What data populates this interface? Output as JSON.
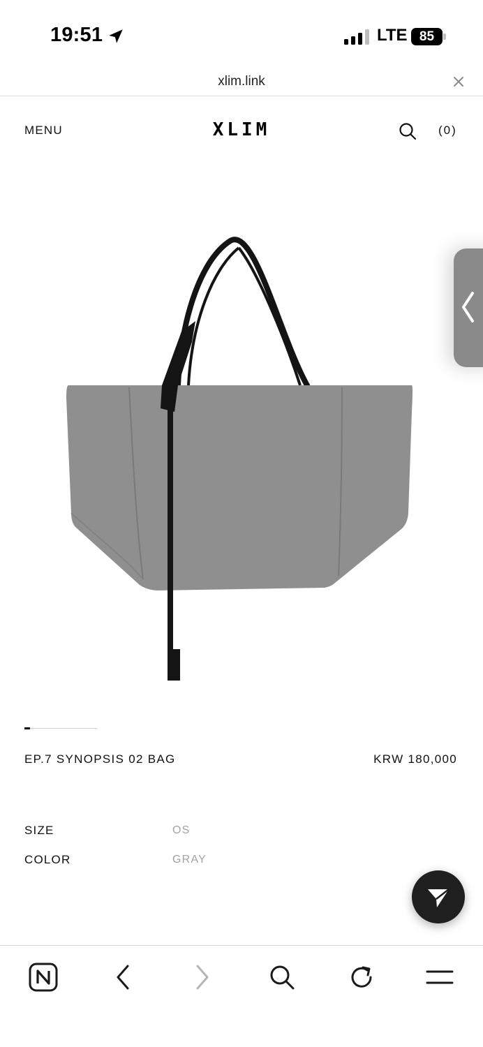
{
  "status_bar": {
    "time": "19:51",
    "network": "LTE",
    "battery": "85"
  },
  "url_bar": {
    "url": "xlim.link"
  },
  "header": {
    "menu_label": "MENU",
    "brand": "XLIM",
    "cart": "(0)"
  },
  "product": {
    "name": "EP.7 SYNOPSIS 02 BAG",
    "price": "KRW 180,000",
    "slide_progress": 0.08,
    "options": [
      {
        "label": "SIZE",
        "value": "OS"
      },
      {
        "label": "COLOR",
        "value": "GRAY"
      }
    ]
  },
  "colors": {
    "bag_gray": "#8f8f8f",
    "strap_black": "#141414",
    "fab_bg": "#1f1f1f"
  },
  "icons": {
    "location": "location-arrow-icon",
    "close": "close-icon",
    "search": "search-icon",
    "handle": "chevron-left-icon",
    "send": "paper-plane-icon",
    "toolbar": [
      "naver-home-icon",
      "back-icon",
      "forward-icon",
      "search-icon",
      "reload-icon",
      "menu-icon"
    ]
  }
}
